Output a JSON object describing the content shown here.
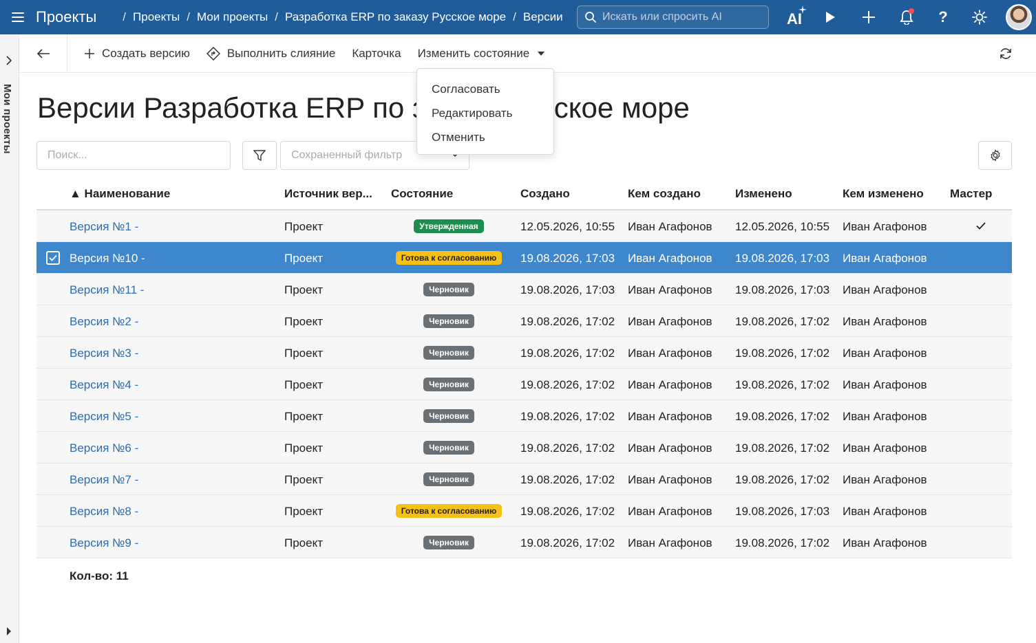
{
  "header": {
    "app_title": "Проекты",
    "breadcrumbs": [
      "Проекты",
      "Мои проекты",
      "Разработка ERP по заказу Русское море",
      "Версии"
    ],
    "search_placeholder": "Искать или спросить AI",
    "ai_label": "AI"
  },
  "sidebar": {
    "label": "Мои проекты"
  },
  "toolbar": {
    "create_version": "Создать версию",
    "merge": "Выполнить слияние",
    "card": "Карточка",
    "change_state": "Изменить состояние"
  },
  "menu": {
    "items": [
      "Согласовать",
      "Редактировать",
      "Отменить"
    ]
  },
  "page": {
    "title": "Версии Разработка ERP по заказу Русское море"
  },
  "filters": {
    "search_placeholder": "Поиск...",
    "saved_filter_placeholder": "Сохраненный фильтр"
  },
  "table": {
    "columns": [
      "▲ Наименование",
      "Источник вер...",
      "Состояние",
      "Создано",
      "Кем создано",
      "Изменено",
      "Кем изменено",
      "Мастер"
    ],
    "rows": [
      {
        "name": "Версия №1 -",
        "source": "Проект",
        "state": "Утвержденная",
        "state_type": "approved",
        "created": "12.05.2026, 10:55",
        "created_by": "Иван Агафонов",
        "modified": "12.05.2026, 10:55",
        "modified_by": "Иван Агафонов",
        "master": true,
        "selected": false
      },
      {
        "name": "Версия №10 -",
        "source": "Проект",
        "state": "Готова к согласованию",
        "state_type": "ready",
        "created": "19.08.2026, 17:03",
        "created_by": "Иван Агафонов",
        "modified": "19.08.2026, 17:03",
        "modified_by": "Иван Агафонов",
        "master": false,
        "selected": true
      },
      {
        "name": "Версия №11 -",
        "source": "Проект",
        "state": "Черновик",
        "state_type": "draft",
        "created": "19.08.2026, 17:03",
        "created_by": "Иван Агафонов",
        "modified": "19.08.2026, 17:03",
        "modified_by": "Иван Агафонов",
        "master": false,
        "selected": false
      },
      {
        "name": "Версия №2 -",
        "source": "Проект",
        "state": "Черновик",
        "state_type": "draft",
        "created": "19.08.2026, 17:02",
        "created_by": "Иван Агафонов",
        "modified": "19.08.2026, 17:02",
        "modified_by": "Иван Агафонов",
        "master": false,
        "selected": false
      },
      {
        "name": "Версия №3 -",
        "source": "Проект",
        "state": "Черновик",
        "state_type": "draft",
        "created": "19.08.2026, 17:02",
        "created_by": "Иван Агафонов",
        "modified": "19.08.2026, 17:02",
        "modified_by": "Иван Агафонов",
        "master": false,
        "selected": false
      },
      {
        "name": "Версия №4 -",
        "source": "Проект",
        "state": "Черновик",
        "state_type": "draft",
        "created": "19.08.2026, 17:02",
        "created_by": "Иван Агафонов",
        "modified": "19.08.2026, 17:02",
        "modified_by": "Иван Агафонов",
        "master": false,
        "selected": false
      },
      {
        "name": "Версия №5 -",
        "source": "Проект",
        "state": "Черновик",
        "state_type": "draft",
        "created": "19.08.2026, 17:02",
        "created_by": "Иван Агафонов",
        "modified": "19.08.2026, 17:02",
        "modified_by": "Иван Агафонов",
        "master": false,
        "selected": false
      },
      {
        "name": "Версия №6 -",
        "source": "Проект",
        "state": "Черновик",
        "state_type": "draft",
        "created": "19.08.2026, 17:02",
        "created_by": "Иван Агафонов",
        "modified": "19.08.2026, 17:02",
        "modified_by": "Иван Агафонов",
        "master": false,
        "selected": false
      },
      {
        "name": "Версия №7 -",
        "source": "Проект",
        "state": "Черновик",
        "state_type": "draft",
        "created": "19.08.2026, 17:02",
        "created_by": "Иван Агафонов",
        "modified": "19.08.2026, 17:02",
        "modified_by": "Иван Агафонов",
        "master": false,
        "selected": false
      },
      {
        "name": "Версия №8 -",
        "source": "Проект",
        "state": "Готова к согласованию",
        "state_type": "ready",
        "created": "19.08.2026, 17:02",
        "created_by": "Иван Агафонов",
        "modified": "19.08.2026, 17:03",
        "modified_by": "Иван Агафонов",
        "master": false,
        "selected": false
      },
      {
        "name": "Версия №9 -",
        "source": "Проект",
        "state": "Черновик",
        "state_type": "draft",
        "created": "19.08.2026, 17:02",
        "created_by": "Иван Агафонов",
        "modified": "19.08.2026, 17:02",
        "modified_by": "Иван Агафонов",
        "master": false,
        "selected": false
      }
    ],
    "count_label": "Кол-во: 11"
  },
  "colors": {
    "topbar": "#1f5c99",
    "selected_row": "#3f87cc",
    "link": "#2b6cb0",
    "badge_approved": "#1e8e4e",
    "badge_ready": "#f6c016",
    "badge_draft": "#6b7075"
  }
}
